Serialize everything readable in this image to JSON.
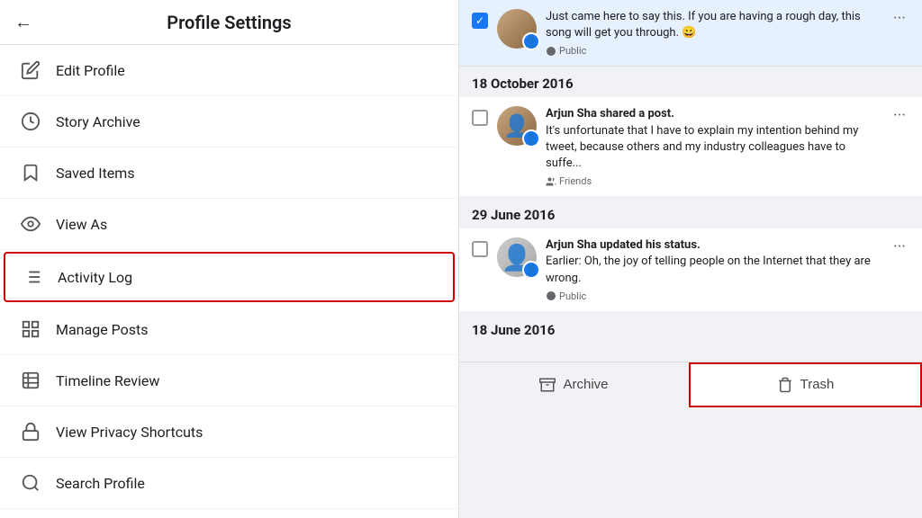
{
  "left": {
    "header": {
      "title": "Profile Settings",
      "back_label": "←"
    },
    "menu_items": [
      {
        "id": "edit-profile",
        "label": "Edit Profile",
        "icon": "pencil"
      },
      {
        "id": "story-archive",
        "label": "Story Archive",
        "icon": "clock"
      },
      {
        "id": "saved-items",
        "label": "Saved Items",
        "icon": "bookmark"
      },
      {
        "id": "view-as",
        "label": "View As",
        "icon": "eye"
      },
      {
        "id": "activity-log",
        "label": "Activity Log",
        "icon": "list",
        "active": true
      },
      {
        "id": "manage-posts",
        "label": "Manage Posts",
        "icon": "grid"
      },
      {
        "id": "timeline-review",
        "label": "Timeline Review",
        "icon": "doc-check"
      },
      {
        "id": "view-privacy-shortcuts",
        "label": "View Privacy Shortcuts",
        "icon": "lock"
      },
      {
        "id": "search-profile",
        "label": "Search Profile",
        "icon": "search"
      }
    ]
  },
  "right": {
    "top_post": {
      "checked": true,
      "text": "Just came here to say this. If you are having a rough day, this song will get you through. 😀",
      "privacy": "Public"
    },
    "sections": [
      {
        "date": "18 October 2016",
        "posts": [
          {
            "author": "Arjun Sha shared a post.",
            "text": "It's unfortunate that I have to explain my intention behind my tweet, because others and my industry colleagues have to suffe...",
            "privacy": "Friends",
            "checked": false
          }
        ]
      },
      {
        "date": "29 June 2016",
        "posts": [
          {
            "author": "Arjun Sha updated his status.",
            "text": "Earlier: Oh, the joy of telling people on the Internet that they are wrong.",
            "privacy": "Public",
            "checked": false
          }
        ]
      },
      {
        "date": "18 June 2016",
        "posts": []
      }
    ],
    "actions": [
      {
        "id": "archive",
        "label": "Archive",
        "icon": "archive"
      },
      {
        "id": "trash",
        "label": "Trash",
        "icon": "trash"
      }
    ]
  }
}
